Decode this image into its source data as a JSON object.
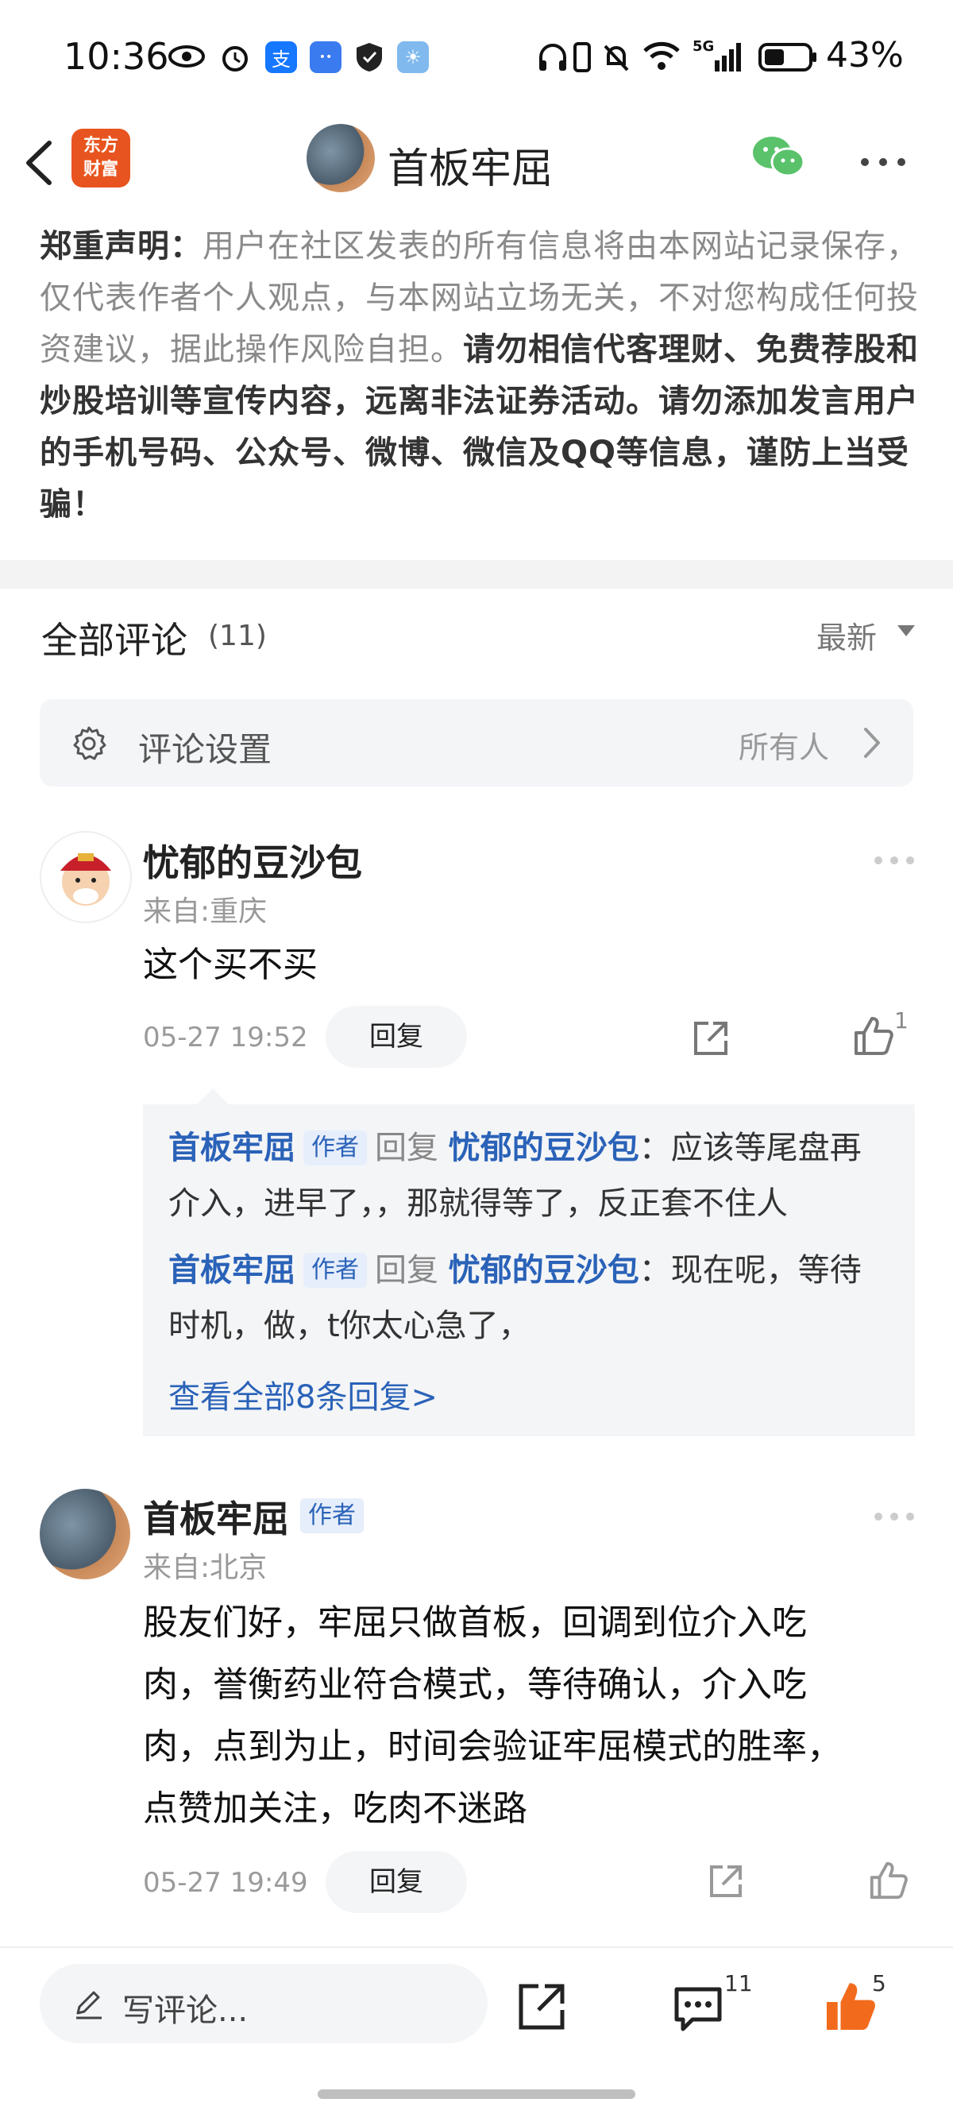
{
  "status_bar": {
    "time": "10:36",
    "battery": "43%",
    "network": "5G"
  },
  "header": {
    "brand_line1": "东方",
    "brand_line2": "财富",
    "title": "首板牢屈"
  },
  "disclaimer": {
    "label": "郑重声明：",
    "text_normal": "用户在社区发表的所有信息将由本网站记录保存，仅代表作者个人观点，与本网站立场无关，不对您构成任何投资建议，据此操作风险自担。",
    "text_bold": "请勿相信代客理财、免费荐股和炒股培训等宣传内容，远离非法证券活动。请勿添加发言用户的手机号码、公众号、微博、微信及QQ等信息，谨防上当受骗！"
  },
  "comments_header": {
    "title": "全部评论",
    "count": "(11)",
    "sort": "最新"
  },
  "settings": {
    "label": "评论设置",
    "value": "所有人"
  },
  "comment1": {
    "user": "忧郁的豆沙包",
    "location": "来自:重庆",
    "content": "这个买不买",
    "date": "05-27 19:52",
    "reply_label": "回复",
    "likes": "1",
    "replies": [
      {
        "author": "首板牢屈",
        "tag": "作者",
        "verb": "回复",
        "target": "忧郁的豆沙包",
        "line1": "：应该等尾盘再",
        "line2": "介入，进早了，，那就得等了，反正套不住人"
      },
      {
        "author": "首板牢屈",
        "tag": "作者",
        "verb": "回复",
        "target": "忧郁的豆沙包",
        "line1": "：现在呢，等待",
        "line2": "时机，做，t你太心急了，"
      }
    ],
    "view_all": "查看全部8条回复>"
  },
  "comment2": {
    "user": "首板牢屈",
    "tag": "作者",
    "location": "来自:北京",
    "lines": [
      "股友们好，牢屈只做首板，回调到位介入吃",
      "肉，誉衡药业符合模式，等待确认，介入吃",
      "肉，点到为止，时间会验证牢屈模式的胜率，",
      "点赞加关注，吃肉不迷路"
    ],
    "date": "05-27 19:49",
    "reply_label": "回复"
  },
  "bottom_bar": {
    "write_placeholder": "写评论...",
    "comment_count": "11",
    "like_count": "5"
  },
  "colors": {
    "accent_blue": "#2a62b8",
    "like_orange": "#f26b1d",
    "brand_orange": "#e8541f"
  }
}
